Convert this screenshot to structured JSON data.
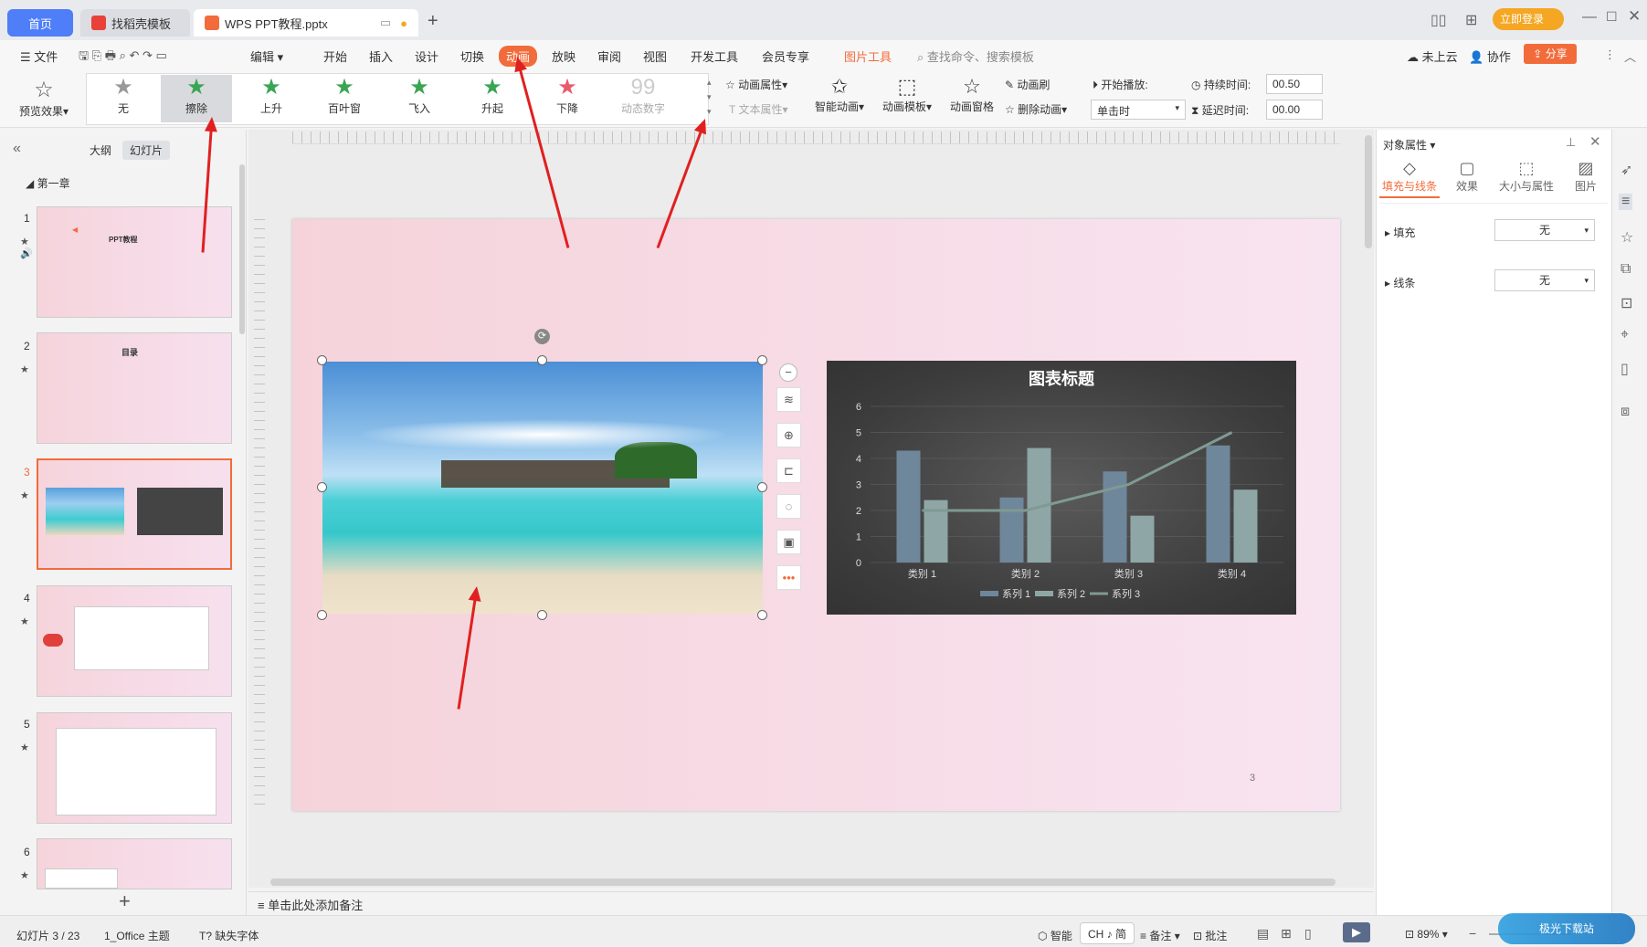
{
  "tabs": {
    "home": "首页",
    "template": "找稻壳模板",
    "doc": "WPS PPT教程.pptx"
  },
  "titlebar": {
    "login": "立即登录"
  },
  "menubar": {
    "file": "文件",
    "edit": "编辑",
    "items": [
      "开始",
      "插入",
      "设计",
      "切换",
      "动画",
      "放映",
      "审阅",
      "视图",
      "开发工具",
      "会员专享"
    ],
    "picture_tools": "图片工具",
    "search": "查找命令、搜索模板",
    "cloud": "未上云",
    "collab": "协作",
    "share": "分享"
  },
  "ribbon": {
    "preview": "预览效果",
    "effects": [
      "无",
      "擦除",
      "上升",
      "百叶窗",
      "飞入",
      "升起",
      "下降",
      "动态数字"
    ],
    "anim_props": "动画属性",
    "text_props": "文本属性",
    "smart_anim": "智能动画",
    "anim_template": "动画模板",
    "anim_pane": "动画窗格",
    "anim_brush": "动画刷",
    "delete_anim": "删除动画",
    "start_play": "开始播放:",
    "start_value": "单击时",
    "duration_label": "持续时间:",
    "duration_value": "00.50",
    "delay_label": "延迟时间:",
    "delay_value": "00.00"
  },
  "leftpanel": {
    "outline_tab": "大纲",
    "slides_tab": "幻灯片",
    "chapter": "第一章",
    "slides": [
      {
        "num": "1",
        "title": "PPT教程"
      },
      {
        "num": "2",
        "title": "目录"
      },
      {
        "num": "3",
        "title": ""
      },
      {
        "num": "4",
        "title": ""
      },
      {
        "num": "5",
        "title": ""
      },
      {
        "num": "6",
        "title": ""
      }
    ]
  },
  "slide": {
    "page_number": "3",
    "notes_placeholder": "单击此处添加备注"
  },
  "chart_data": {
    "type": "bar",
    "title": "图表标题",
    "categories": [
      "类别 1",
      "类别 2",
      "类别 3",
      "类别 4"
    ],
    "series": [
      {
        "name": "系列 1",
        "values": [
          4.3,
          2.5,
          3.5,
          4.5
        ]
      },
      {
        "name": "系列 2",
        "values": [
          2.4,
          4.4,
          1.8,
          2.8
        ]
      },
      {
        "name": "系列 3",
        "values": [
          2,
          2,
          3,
          5
        ],
        "render": "line"
      }
    ],
    "ylim": [
      0,
      6
    ],
    "yticks": [
      "0",
      "1",
      "2",
      "3",
      "4",
      "5",
      "6"
    ],
    "legend": "bottom",
    "colors": {
      "s1": "#6f879b",
      "s2": "#8fa6a6",
      "s3": "#7f9a92"
    }
  },
  "rightpanel": {
    "title": "对象属性",
    "tabs": [
      "填充与线条",
      "效果",
      "大小与属性",
      "图片"
    ],
    "fill_label": "填充",
    "fill_value": "无",
    "line_label": "线条",
    "line_value": "无"
  },
  "statusbar": {
    "slide_info": "幻灯片 3 / 23",
    "theme": "1_Office 主题",
    "missing_font": "缺失字体",
    "smart": "智能",
    "ime": "CH ♪ 简",
    "notes": "备注",
    "comments": "批注",
    "zoom": "89%"
  },
  "colors": {
    "accent": "#f26c3b",
    "brand": "#4e7ef8",
    "annotation_arrows": "#e02020"
  }
}
